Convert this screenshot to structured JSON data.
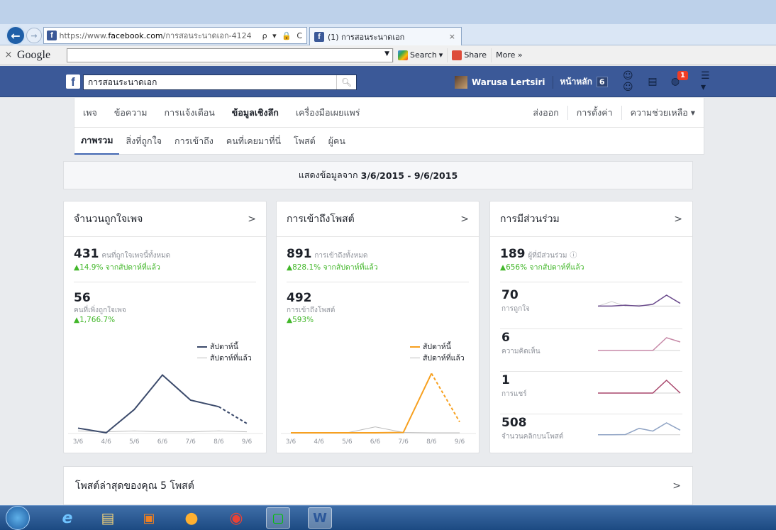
{
  "browser": {
    "url_prefix": "https://www.",
    "url_domain": "facebook.com",
    "url_rest": "/การสอนระนาดเอก-4124",
    "url_icons": "ρ ▾ 🔒 C",
    "tab_title": "(1) การสอนระนาดเอก",
    "tab_close": "×"
  },
  "google_toolbar": {
    "close": "×",
    "logo": "Google",
    "search_label": "Search",
    "share_label": "Share",
    "more_label": "More »"
  },
  "fb": {
    "logo": "f",
    "search_value": "การสอนระนาดเอก",
    "user_name": "Warusa Lertsiri",
    "home_label": "หน้าหลัก",
    "home_count": "6",
    "notif_count": "1"
  },
  "page_nav": {
    "top_items": [
      "เพจ",
      "ข้อความ",
      "การแจ้งเตือน",
      "ข้อมูลเชิงลึก",
      "เครื่องมือเผยแพร่"
    ],
    "right_items": [
      "ส่งออก",
      "การตั้งค่า",
      "ความช่วยเหลือ ▾"
    ],
    "sub_items": [
      "ภาพรวม",
      "สิ่งที่ถูกใจ",
      "การเข้าถึง",
      "คนที่เคยมาที่นี่",
      "โพสต์",
      "ผู้คน"
    ]
  },
  "date_banner": {
    "label": "แสดงข้อมูลจาก",
    "range": "3/6/2015 - 9/6/2015"
  },
  "cards": {
    "likes": {
      "title": "จำนวนถูกใจเพจ",
      "total": "431",
      "total_label": "คนที่ถูกใจเพจนี้ทั้งหมด",
      "total_change": "▲14.9% จากสัปดาห์ที่แล้ว",
      "new": "56",
      "new_label": "คนที่เพิ่งถูกใจเพจ",
      "new_change": "▲1,766.7%",
      "legend_this": "สัปดาห์นี้",
      "legend_last": "สัปดาห์ที่แล้ว"
    },
    "reach": {
      "title": "การเข้าถึงโพสต์",
      "total": "891",
      "total_label": "การเข้าถึงทั้งหมด",
      "total_change": "▲828.1% จากสัปดาห์ที่แล้ว",
      "post": "492",
      "post_label": "การเข้าถึงโพสต์",
      "post_change": "▲593%",
      "legend_this": "สัปดาห์นี้",
      "legend_last": "สัปดาห์ที่แล้ว"
    },
    "engagement": {
      "title": "การมีส่วนร่วม",
      "total": "189",
      "total_label": "ผู้ที่มีส่วนร่วม",
      "total_change": "▲656% จากสัปดาห์ที่แล้ว",
      "rows": [
        {
          "value": "70",
          "label": "การถูกใจ"
        },
        {
          "value": "6",
          "label": "ความคิดเห็น"
        },
        {
          "value": "1",
          "label": "การแชร์"
        },
        {
          "value": "508",
          "label": "จำนวนคลิกบนโพสต์"
        }
      ]
    }
  },
  "latest_posts": {
    "title": "โพสต์ล่าสุดของคุณ 5 โพสต์"
  },
  "colors": {
    "fb_blue": "#3b5998",
    "likes_line": "#3b4a6b",
    "reach_line": "#f7a01f",
    "last_week_line": "#bdbdbd",
    "green": "#42b72a"
  },
  "chart_data": [
    {
      "type": "line",
      "categories": [
        "3/6",
        "4/6",
        "5/6",
        "6/6",
        "7/6",
        "8/6",
        "9/6"
      ],
      "series": [
        {
          "name": "สัปดาห์นี้",
          "values": [
            5,
            0,
            25,
            62,
            35,
            28,
            10
          ]
        },
        {
          "name": "สัปดาห์ที่แล้ว",
          "values": [
            2,
            1,
            2,
            1,
            1,
            2,
            1
          ]
        }
      ],
      "ylim": [
        0,
        70
      ]
    },
    {
      "type": "line",
      "categories": [
        "3/6",
        "4/6",
        "5/6",
        "6/6",
        "7/6",
        "8/6",
        "9/6"
      ],
      "series": [
        {
          "name": "สัปดาห์นี้",
          "values": [
            0,
            0,
            0,
            0,
            2,
            300,
            55
          ]
        },
        {
          "name": "สัปดาห์ที่แล้ว",
          "values": [
            0,
            0,
            0,
            30,
            2,
            0,
            0
          ]
        }
      ],
      "ylim": [
        0,
        330
      ]
    }
  ],
  "sparklines": [
    {
      "this": [
        2,
        2,
        3,
        2,
        4,
        14,
        5
      ],
      "last": [
        2,
        7,
        2,
        3,
        2,
        2,
        2
      ]
    },
    {
      "this": [
        0,
        0,
        0,
        0,
        0,
        6,
        4
      ],
      "last": [
        0,
        0,
        0,
        0,
        0,
        0,
        0
      ]
    },
    {
      "this": [
        0,
        0,
        0,
        0,
        0,
        1,
        0
      ],
      "last": [
        0,
        0,
        0,
        0,
        0,
        0,
        0
      ]
    },
    {
      "this": [
        5,
        5,
        6,
        40,
        25,
        70,
        30
      ],
      "last": [
        5,
        5,
        5,
        5,
        5,
        5,
        5
      ]
    }
  ]
}
